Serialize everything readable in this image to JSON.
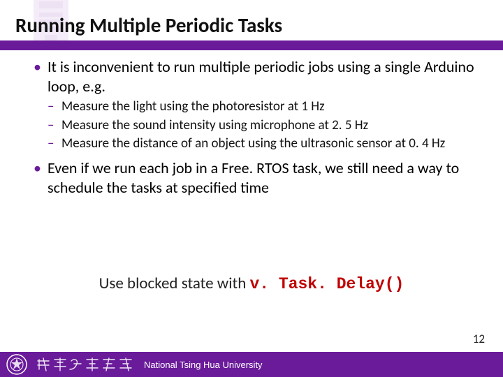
{
  "title": "Running Multiple Periodic Tasks",
  "bullets": {
    "b1": "It is inconvenient to run multiple periodic jobs using a single Arduino loop, e.g.",
    "sub": {
      "s1": "Measure the light using the photoresistor at 1 Hz",
      "s2": "Measure the sound intensity using microphone at 2. 5 Hz",
      "s3": "Measure the distance of an object using the ultrasonic sensor at 0. 4 Hz"
    },
    "b2": "Even if we run each job in a Free. RTOS task, we still need a way to schedule the tasks at specified time"
  },
  "callout": {
    "pre": "Use blocked state with ",
    "code": "v. Task. Delay()"
  },
  "footer": {
    "university": "National Tsing Hua University"
  },
  "page": "12",
  "colors": {
    "purple": "#6a1b9a",
    "red": "#c00000"
  }
}
